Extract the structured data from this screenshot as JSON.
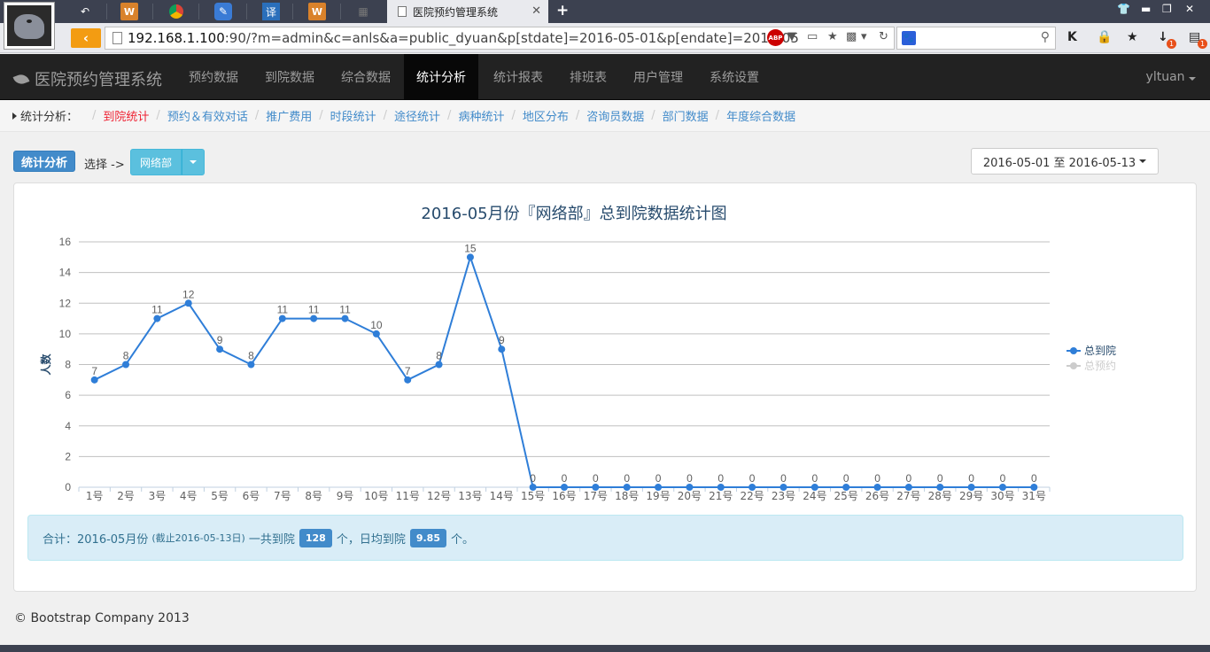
{
  "browser": {
    "active_tab_title": "医院预约管理系统",
    "url_host": "192.168.1.100",
    "url_rest": ":90/?m=admin&c=anls&a=public_dyuan&p[stdate]=2016-05-01&p[endate]=2016-05",
    "tab_icons": [
      "undo-icon",
      "wps-icon",
      "chrome-icon",
      "pen-icon",
      "translate-icon",
      "wps-icon",
      "grid-icon"
    ],
    "translate_glyph": "译",
    "abp_label": "ABP",
    "search_engine_glyph": "🐾",
    "badge_count_1": "1",
    "badge_count_2": "1"
  },
  "navbar": {
    "brand": "医院预约管理系统",
    "items": [
      {
        "label": "预约数据",
        "active": false
      },
      {
        "label": "到院数据",
        "active": false
      },
      {
        "label": "综合数据",
        "active": false
      },
      {
        "label": "统计分析",
        "active": true
      },
      {
        "label": "统计报表",
        "active": false
      },
      {
        "label": "排班表",
        "active": false
      },
      {
        "label": "用户管理",
        "active": false
      },
      {
        "label": "系统设置",
        "active": false
      }
    ],
    "user": "yltuan"
  },
  "breadcrumb": {
    "head": "统计分析：",
    "items": [
      {
        "label": "到院统计",
        "current": true
      },
      {
        "label": "预约＆有效对话",
        "current": false
      },
      {
        "label": "推广费用",
        "current": false
      },
      {
        "label": "时段统计",
        "current": false
      },
      {
        "label": "途径统计",
        "current": false
      },
      {
        "label": "病种统计",
        "current": false
      },
      {
        "label": "地区分布",
        "current": false
      },
      {
        "label": "咨询员数据",
        "current": false
      },
      {
        "label": "部门数据",
        "current": false
      },
      {
        "label": "年度综合数据",
        "current": false
      }
    ]
  },
  "toolbar": {
    "section_button": "统计分析",
    "select_label": "选择 ->",
    "department": "网络部",
    "date_range": "2016-05-01 至 2016-05-13"
  },
  "chart_data": {
    "type": "line",
    "title": "2016-05月份『网络部』总到院数据统计图",
    "ylabel": "人数",
    "xlabel": "",
    "ylim": [
      0,
      16
    ],
    "yticks": [
      0,
      2,
      4,
      6,
      8,
      10,
      12,
      14,
      16
    ],
    "grid": true,
    "legend_position": "right",
    "categories": [
      "1号",
      "2号",
      "3号",
      "4号",
      "5号",
      "6号",
      "7号",
      "8号",
      "9号",
      "10号",
      "11号",
      "12号",
      "13号",
      "14号",
      "15号",
      "16号",
      "17号",
      "18号",
      "19号",
      "20号",
      "21号",
      "22号",
      "23号",
      "24号",
      "25号",
      "26号",
      "27号",
      "28号",
      "29号",
      "30号",
      "31号"
    ],
    "series": [
      {
        "name": "总到院",
        "color": "#2f7ed8",
        "visible": true,
        "values": [
          7,
          8,
          11,
          12,
          9,
          8,
          11,
          11,
          11,
          10,
          7,
          8,
          15,
          9,
          0,
          0,
          0,
          0,
          0,
          0,
          0,
          0,
          0,
          0,
          0,
          0,
          0,
          0,
          0,
          0,
          0
        ]
      },
      {
        "name": "总预约",
        "color": "#cccccc",
        "visible": false,
        "values": []
      }
    ]
  },
  "summary": {
    "prefix": "合计：2016-05月份",
    "note": "(截止2016-05-13日)",
    "total_text": "一共到院",
    "total": "128",
    "unit1": "个，日均到院",
    "avg": "9.85",
    "unit2": "个。"
  },
  "footer": "© Bootstrap Company 2013"
}
